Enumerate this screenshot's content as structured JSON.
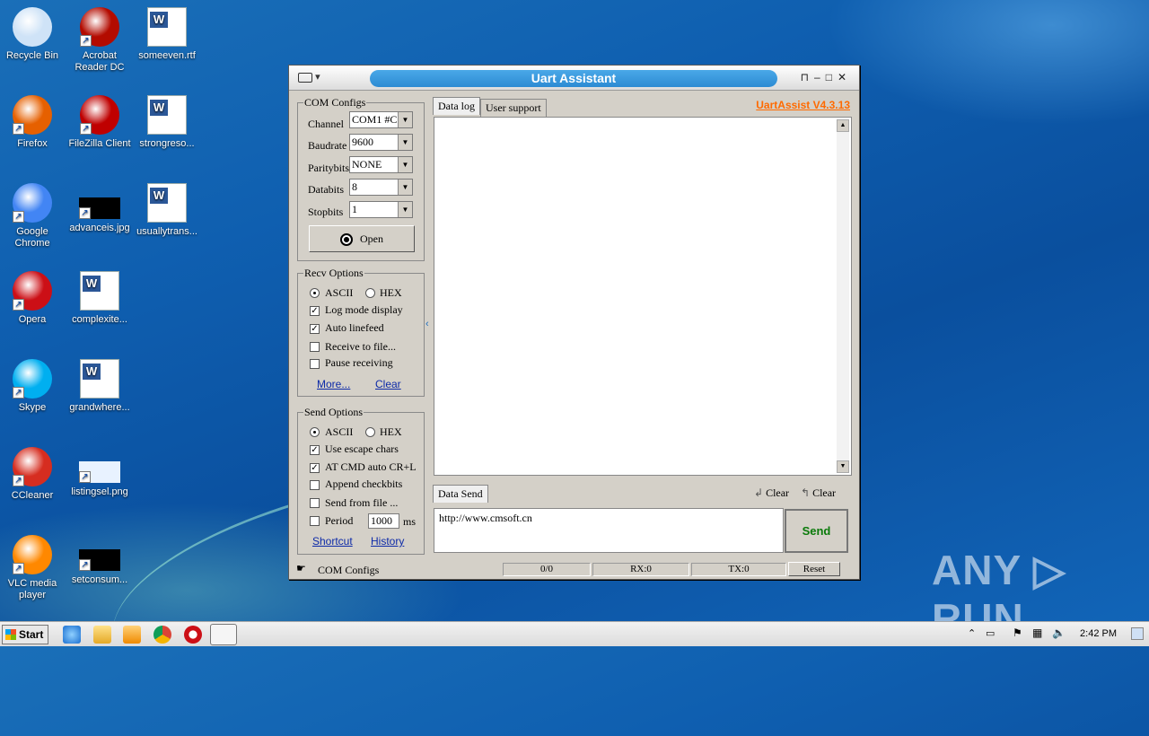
{
  "desktop": {
    "icons": [
      {
        "label": "Recycle Bin",
        "icon": "recycle-bin-icon",
        "color": "#cfe3f7"
      },
      {
        "label": "Acrobat Reader DC",
        "icon": "acrobat-icon",
        "color": "#b30b00"
      },
      {
        "label": "someeven.rtf",
        "icon": "word-doc-icon",
        "color": "#2b5797"
      },
      {
        "label": "Firefox",
        "icon": "firefox-icon",
        "color": "#e66000"
      },
      {
        "label": "FileZilla Client",
        "icon": "filezilla-icon",
        "color": "#bf0000"
      },
      {
        "label": "strongreso...",
        "icon": "word-doc-icon",
        "color": "#2b5797"
      },
      {
        "label": "Google Chrome",
        "icon": "chrome-icon",
        "color": "#4285f4"
      },
      {
        "label": "advanceis.jpg",
        "icon": "image-file-icon",
        "color": "#000000"
      },
      {
        "label": "usuallytrans...",
        "icon": "word-doc-icon",
        "color": "#2b5797"
      },
      {
        "label": "Opera",
        "icon": "opera-icon",
        "color": "#cc0f16"
      },
      {
        "label": "complexite...",
        "icon": "word-doc-icon",
        "color": "#2b5797"
      },
      {
        "label": "Skype",
        "icon": "skype-icon",
        "color": "#00aff0"
      },
      {
        "label": "grandwhere...",
        "icon": "word-doc-icon",
        "color": "#2b5797"
      },
      {
        "label": "CCleaner",
        "icon": "ccleaner-icon",
        "color": "#d62d20"
      },
      {
        "label": "listingsel.png",
        "icon": "image-file-icon",
        "color": "#e8f2ff"
      },
      {
        "label": "VLC media player",
        "icon": "vlc-icon",
        "color": "#ff8800"
      },
      {
        "label": "setconsum...",
        "icon": "image-file-icon",
        "color": "#000000"
      }
    ]
  },
  "window": {
    "title": "Uart Assistant",
    "sysmenu": "▾",
    "version_link": "UartAssist V4.3.13",
    "com_configs": {
      "legend": "COM Configs",
      "channel_label": "Channel",
      "channel_value": "COM1 #C",
      "baudrate_label": "Baudrate",
      "baudrate_value": "9600",
      "paritybits_label": "Paritybits",
      "paritybits_value": "NONE",
      "databits_label": "Databits",
      "databits_value": "8",
      "stopbits_label": "Stopbits",
      "stopbits_value": "1",
      "open_button": "Open"
    },
    "recv_options": {
      "legend": "Recv Options",
      "ascii": "ASCII",
      "hex": "HEX",
      "log_mode": "Log mode display",
      "auto_linefeed": "Auto linefeed",
      "receive_to_file": "Receive to file...",
      "pause_receiving": "Pause receiving",
      "more_link": "More...",
      "clear_link": "Clear"
    },
    "send_options": {
      "legend": "Send Options",
      "ascii": "ASCII",
      "hex": "HEX",
      "use_escape": "Use escape chars",
      "at_cmd": "AT CMD auto CR+L",
      "append_checkbits": "Append checkbits",
      "send_from_file": "Send from file ...",
      "period_label": "Period",
      "period_value": "1000",
      "period_unit": "ms",
      "shortcut_link": "Shortcut",
      "history_link": "History"
    },
    "tabs": {
      "data_log": "Data log",
      "user_support": "User support"
    },
    "data_send": {
      "tab": "Data Send",
      "clear1": "Clear",
      "clear2": "Clear",
      "input_value": "http://www.cmsoft.cn",
      "send_button": "Send"
    },
    "status": {
      "left_text": "COM Configs",
      "counter": "0/0",
      "rx": "RX:0",
      "tx": "TX:0",
      "reset": "Reset"
    }
  },
  "taskbar": {
    "start_label": "Start",
    "clock": "2:42 PM"
  },
  "watermark": "ANY ▷ RUN"
}
